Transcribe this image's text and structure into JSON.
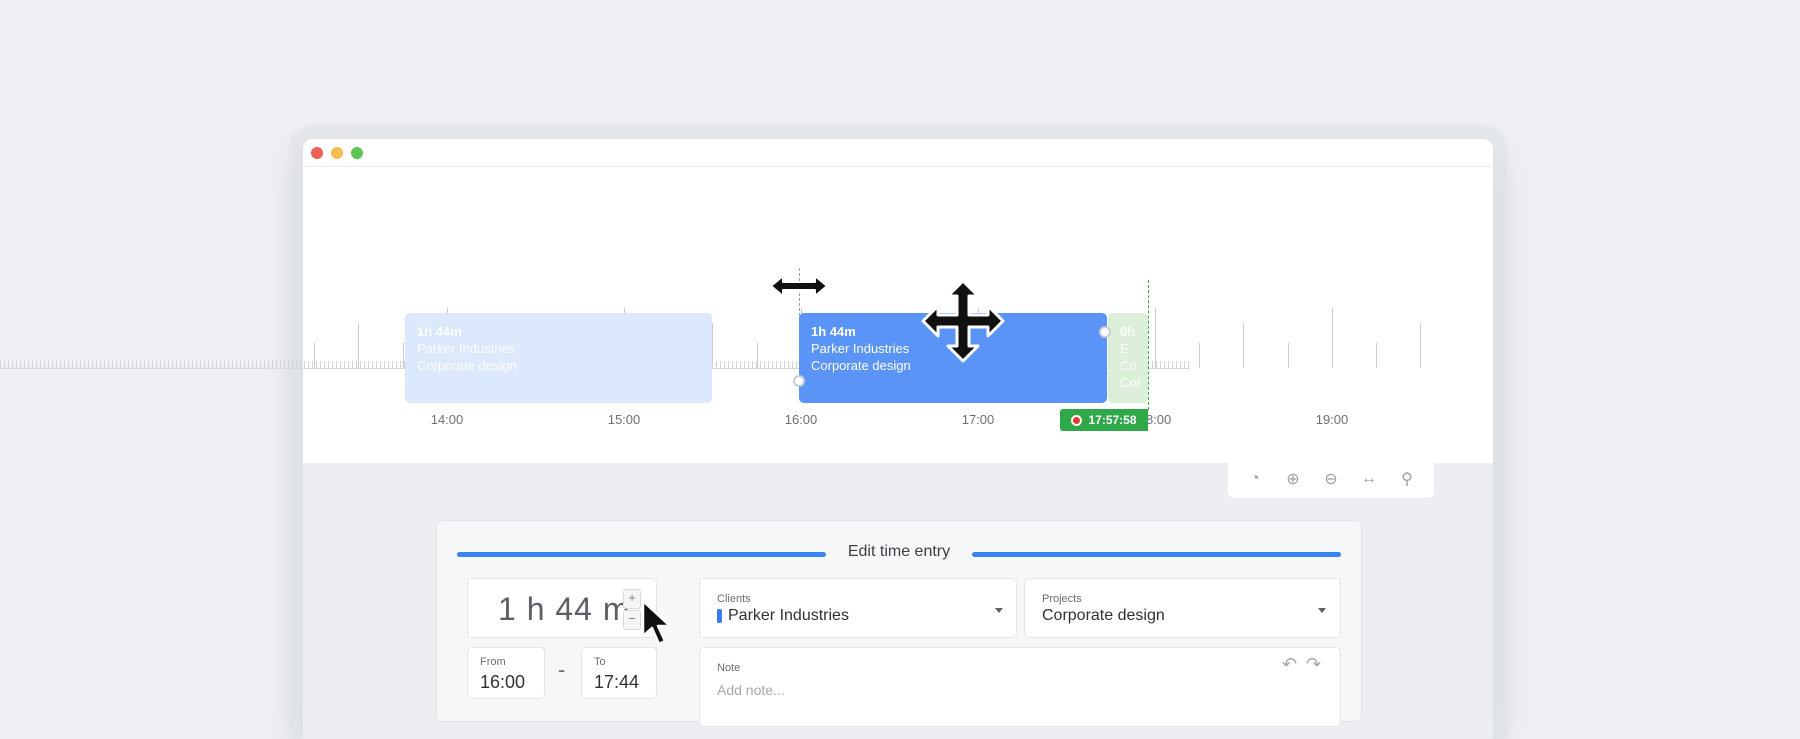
{
  "window": {
    "controls": [
      "close",
      "minimize",
      "maximize"
    ]
  },
  "timeline": {
    "hours": [
      "14:00",
      "15:00",
      "16:00",
      "17:00",
      "18:00",
      "19:00"
    ],
    "entries": [
      {
        "duration": "1h 44m",
        "client": "Parker Industries",
        "project": "Corporate design",
        "state": "ghost"
      },
      {
        "duration": "1h 44m",
        "client": "Parker Industries",
        "project": "Corporate design",
        "state": "active"
      },
      {
        "duration": "0h",
        "client": "E Co",
        "project": "Cor",
        "state": "running"
      }
    ],
    "now": "17:57:58"
  },
  "toolbar": {
    "icons": [
      "clock-add-icon",
      "zoom-in-icon",
      "zoom-out-icon",
      "fit-width-icon",
      "location-pin-icon"
    ]
  },
  "edit": {
    "title": "Edit time entry",
    "duration": "1 h 44 m",
    "stepper_plus": "+",
    "stepper_minus": "−",
    "from_label": "From",
    "from_hour": "16",
    "from_min": "00",
    "to_label": "To",
    "to_hour": "17",
    "to_min": "44",
    "separator": "-",
    "clients_label": "Clients",
    "clients_value": "Parker Industries",
    "client_color": "#3a7bf0",
    "projects_label": "Projects",
    "projects_value": "Corporate design",
    "note_label": "Note",
    "note_placeholder": "Add note..."
  },
  "colors": {
    "accent": "#3a86f0",
    "entry": "#5b94f7",
    "running": "#2fa84a"
  }
}
